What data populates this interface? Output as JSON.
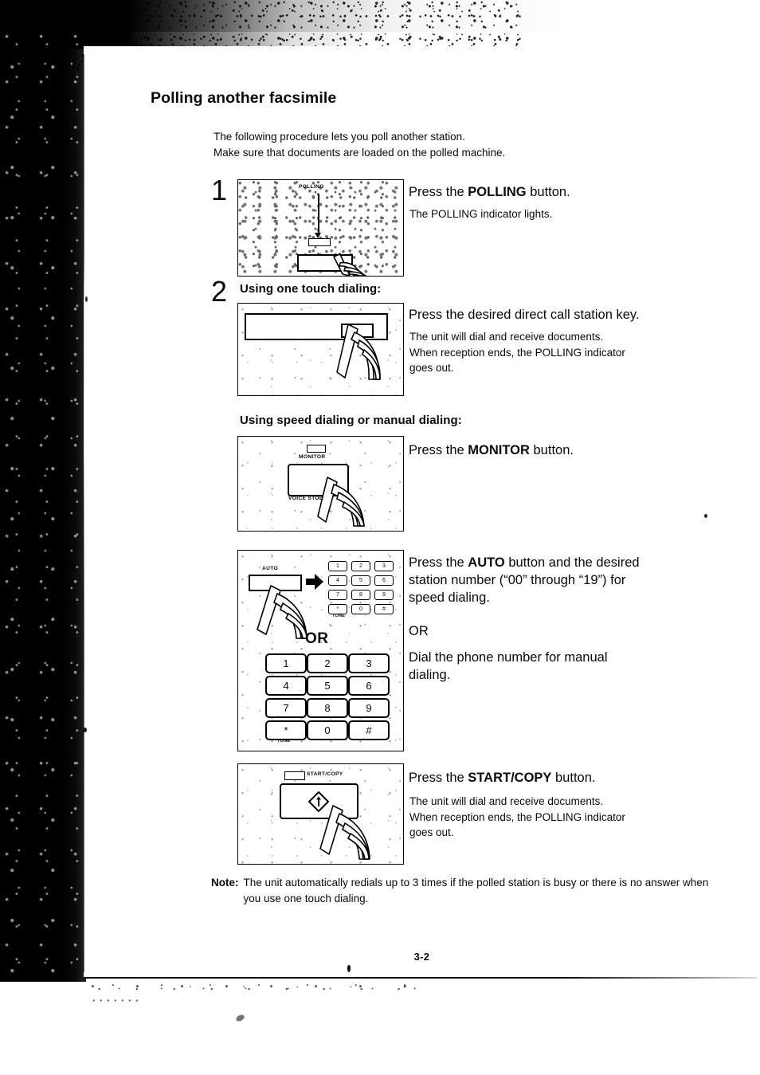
{
  "document": {
    "title": "Polling another facsimile",
    "page_number": "3-2",
    "intro_line1": "The following procedure lets you poll another station.",
    "intro_line2": "Make sure that documents are loaded on the polled machine."
  },
  "steps": [
    {
      "number": "1",
      "illustration": {
        "indicator_label": "POLLING",
        "type": "polling-button-panel"
      },
      "lead_before": "Press the ",
      "lead_bold": "POLLING",
      "lead_after": " button.",
      "detail_lines": [
        "The POLLING indicator lights."
      ]
    },
    {
      "number": "2",
      "subheading": "Using one touch dialing:",
      "illustration": {
        "type": "one-touch-key-panel"
      },
      "lead_before": "Press the desired direct call station key.",
      "lead_bold": "",
      "lead_after": "",
      "detail_lines": [
        "The unit will dial and receive documents.",
        "When reception ends, the POLLING indicator",
        "goes out."
      ]
    }
  ],
  "speed_dialing": {
    "subheading": "Using speed dialing or manual dialing:",
    "monitor_block": {
      "illustration": {
        "type": "monitor-button-panel",
        "indicator_label": "MONITOR",
        "secondary_label": "VOICE STDB"
      },
      "lead_before": "Press the ",
      "lead_bold": "MONITOR",
      "lead_after": " button."
    },
    "auto_block": {
      "illustration": {
        "type": "auto-keypad-panel",
        "auto_label": "AUTO",
        "or_label": "OR",
        "tone_label": "TONE",
        "keypad_keys": [
          "1",
          "2",
          "3",
          "4",
          "5",
          "6",
          "7",
          "8",
          "9",
          "*",
          "0",
          "#"
        ]
      },
      "lead_before": "Press the ",
      "lead_bold": "AUTO",
      "lead_after": " button and the desired",
      "lead_line2": "station number (“00” through “19”) for",
      "lead_line3": "speed dialing.",
      "or_text": "OR",
      "manual_line1": "Dial the phone number for manual",
      "manual_line2": "dialing."
    },
    "start_block": {
      "illustration": {
        "type": "start-copy-button-panel",
        "indicator_label": "START/COPY"
      },
      "lead_before": "Press the ",
      "lead_bold": "START/COPY",
      "lead_after": " button.",
      "detail_lines": [
        "The unit will dial and receive documents.",
        "When reception ends, the POLLING indicator",
        "goes out."
      ]
    }
  },
  "note": {
    "label": "Note:",
    "line1": "The unit automatically redials up to 3 times if the polled station is busy or there",
    "line2": "is no answer when you use one touch dialing."
  }
}
